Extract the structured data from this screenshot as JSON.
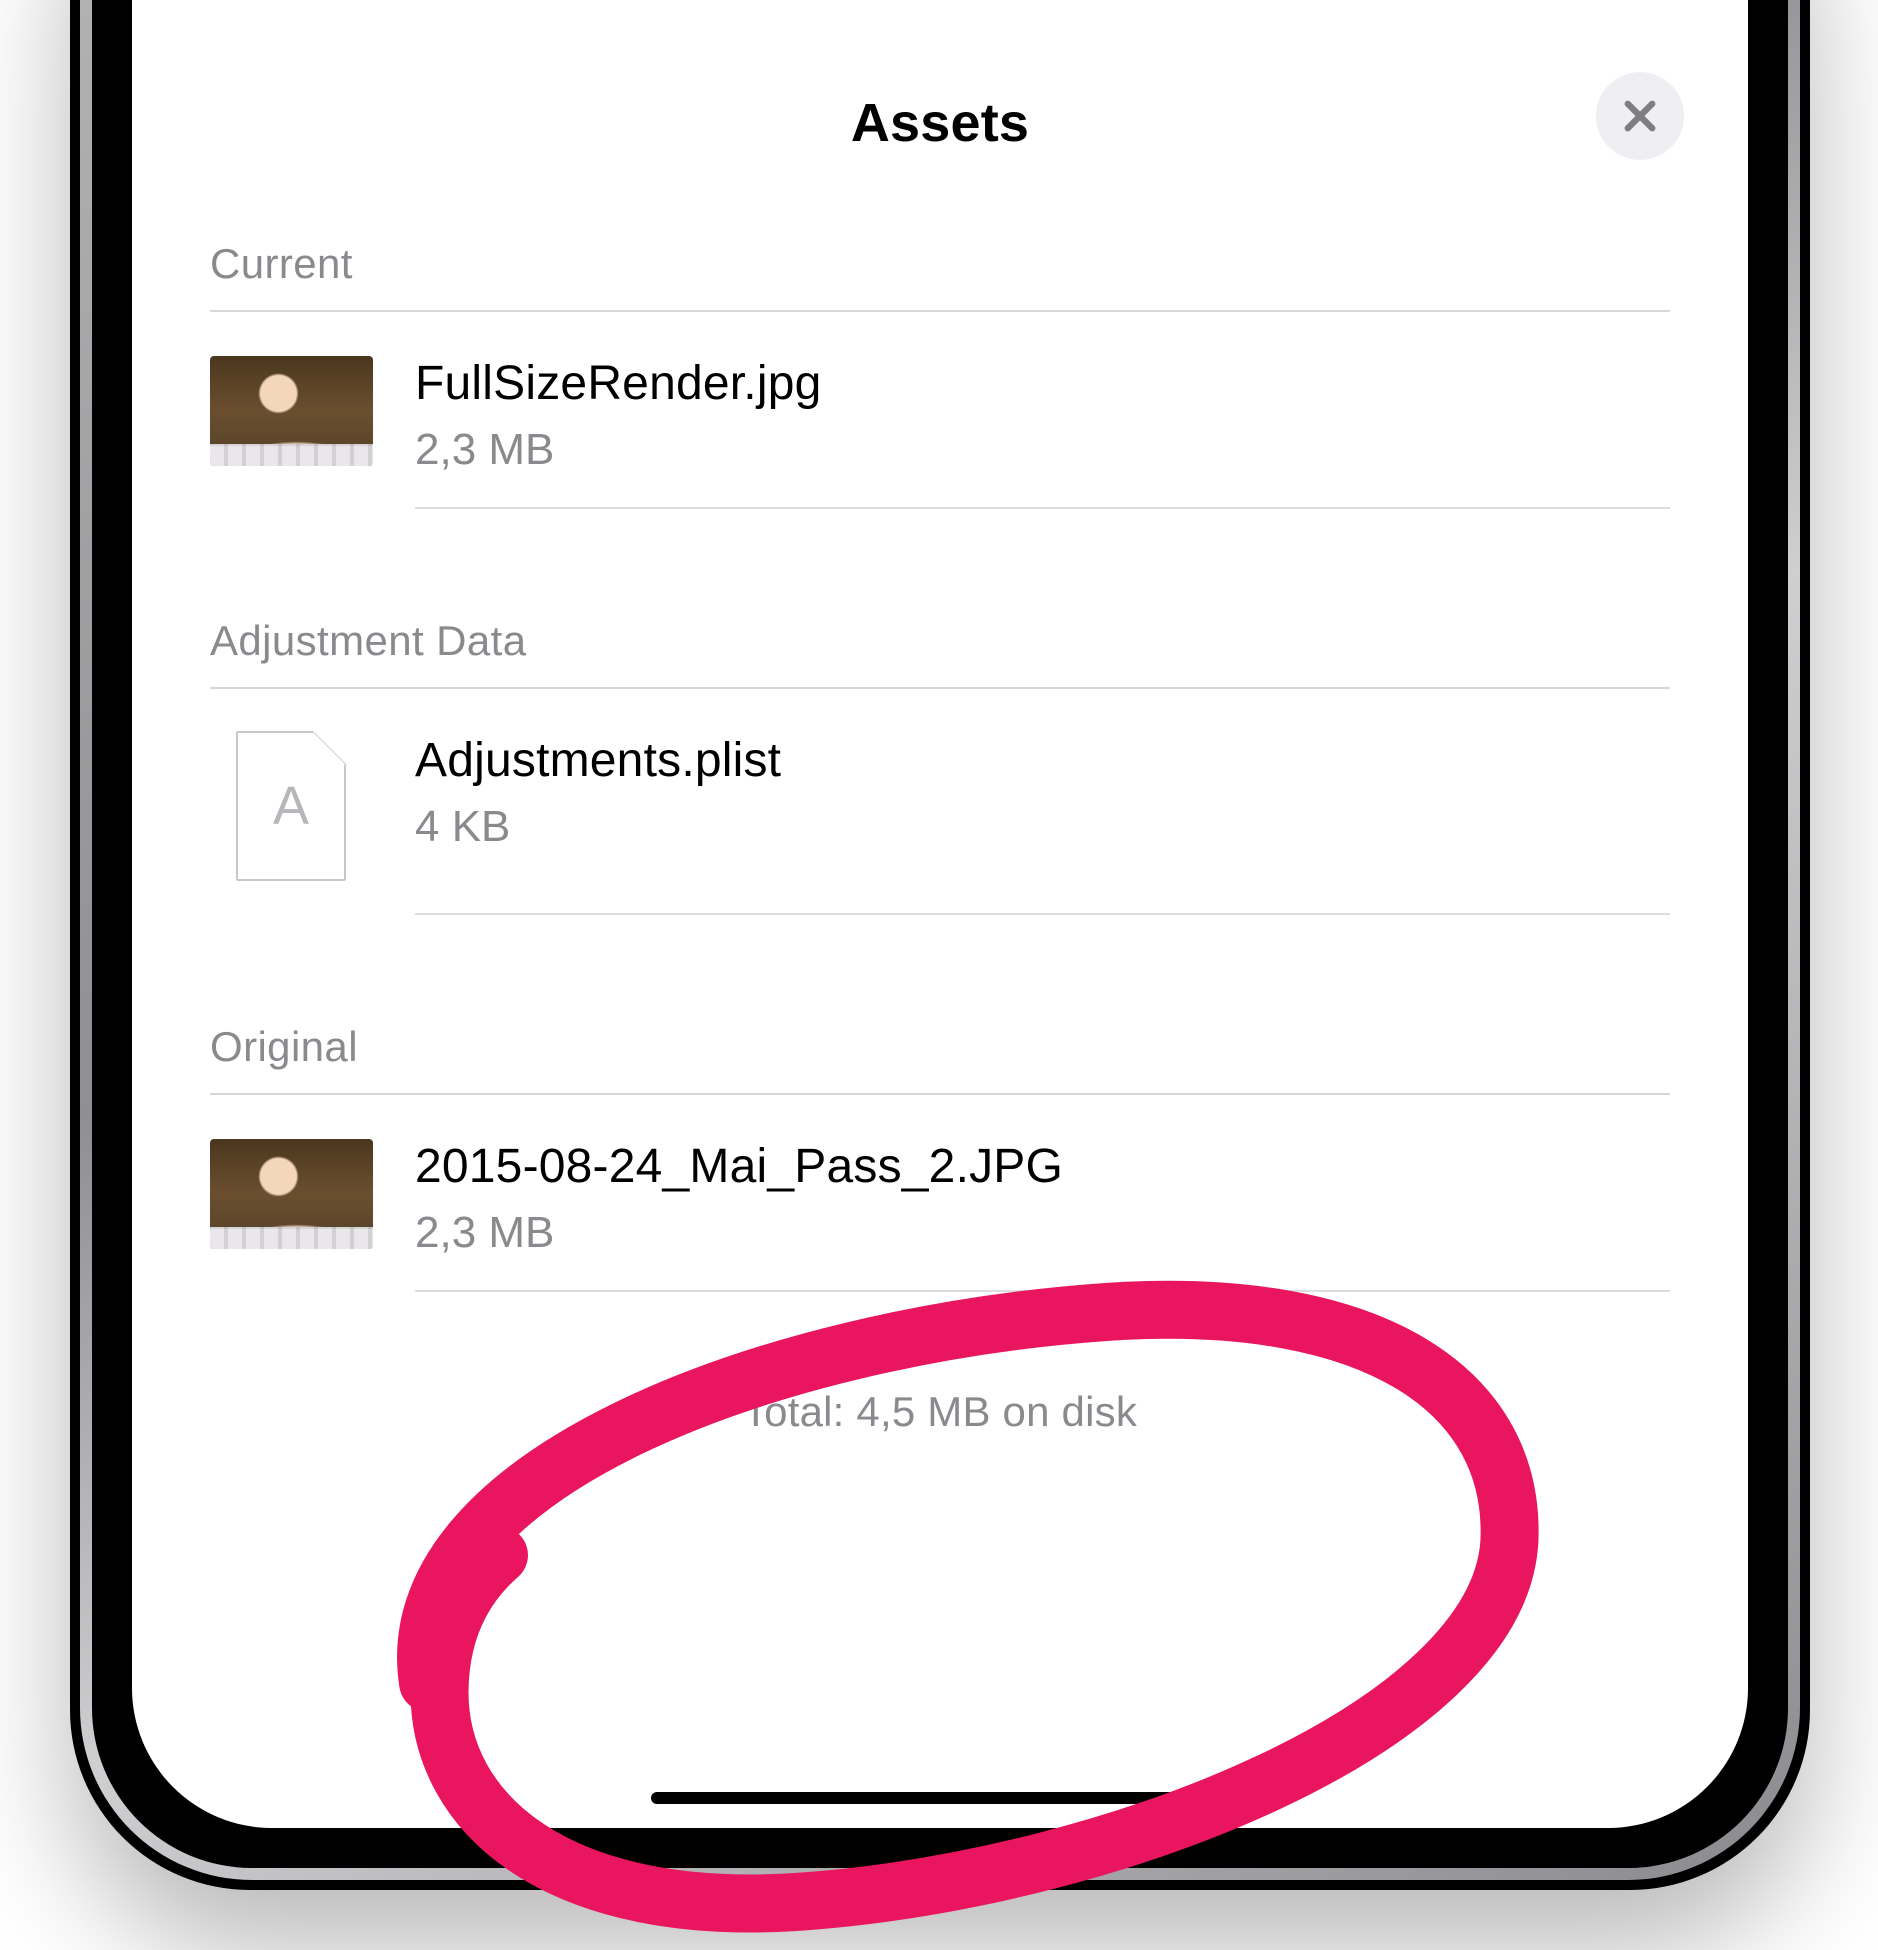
{
  "header": {
    "title": "Assets",
    "close_icon_name": "close-icon"
  },
  "sections": [
    {
      "header": "Current",
      "items": [
        {
          "type": "photo",
          "name": "FullSizeRender.jpg",
          "size": "2,3 MB"
        }
      ]
    },
    {
      "header": "Adjustment Data",
      "items": [
        {
          "type": "file",
          "icon_letter": "A",
          "name": "Adjustments.plist",
          "size": "4 KB"
        }
      ]
    },
    {
      "header": "Original",
      "items": [
        {
          "type": "photo",
          "name": "2015-08-24_Mai_Pass_2.JPG",
          "size": "2,3 MB"
        }
      ]
    }
  ],
  "footer": {
    "total_text": "Total: 4,5 MB on disk"
  },
  "annotation": {
    "color": "#e9155f"
  }
}
